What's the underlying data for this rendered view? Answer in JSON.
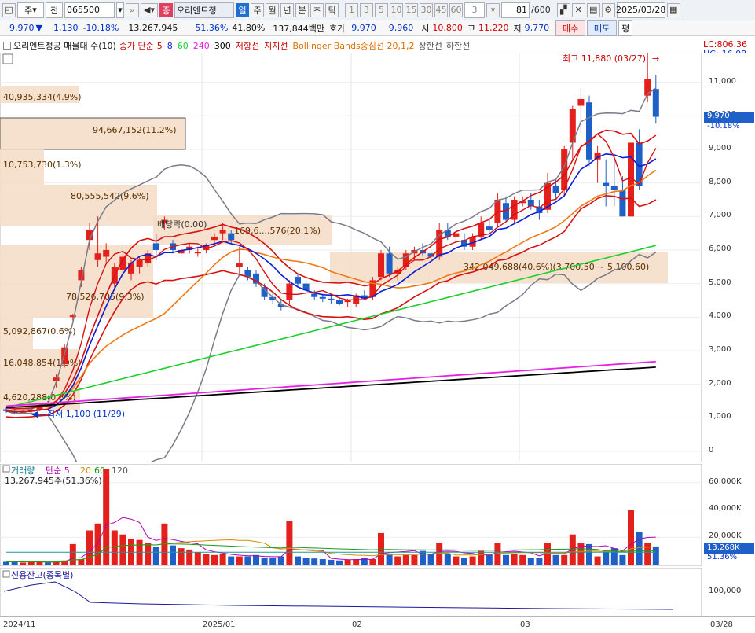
{
  "toolbar": {
    "stock_type": "주",
    "search_type": "전",
    "code": "065500",
    "market_badge": "증",
    "stock_name": "오리엔트정",
    "periods": [
      "일",
      "주",
      "월",
      "년",
      "분",
      "초",
      "틱"
    ],
    "minute_steps": [
      "1",
      "3",
      "5",
      "10",
      "15",
      "30",
      "45",
      "60"
    ],
    "custom_step": "3",
    "page_count": "81",
    "page_total": "/600",
    "date": "2025/03/28"
  },
  "quote": {
    "price": "9,970",
    "direction": "▼",
    "change": "1,130",
    "change_rate": "-10.18%",
    "volume": "13,267,945",
    "volume_rate": "51.36%",
    "turnover": "41.80%",
    "amount": "137,844백만",
    "ask_label": "호가",
    "ask1": "9,970",
    "ask2": "9,960",
    "open_label": "시",
    "open": "10,800",
    "high_label": "고",
    "high": "11,220",
    "low_label": "저",
    "low": "9,770",
    "buy_btn": "매수",
    "sell_btn": "매도",
    "eval_btn": "평"
  },
  "legend": {
    "stock": "오리엔트정공 매물대 수(10)",
    "close_label": "종가 단순",
    "ma": [
      "5",
      "8",
      "60",
      "240",
      "300"
    ],
    "lowline": "저항선",
    "support": "지지선",
    "bollinger": "Bollinger Bands중심선 20,1,2",
    "upper": "상한선",
    "lower": "하한선"
  },
  "price_pane": {
    "lc_label": "LC:806.36",
    "hc_label": "HC:-16.08",
    "high_note": "최고 11,880 (03/27)",
    "low_note": "최저 1,100 (11/29)",
    "dividend_note": "배당락(0.00)",
    "current_tag": "9,970",
    "current_rate": "-10.18%",
    "y_ticks": [
      "11,000",
      "10,000",
      "9,000",
      "8,000",
      "7,000",
      "6,000",
      "5,000",
      "4,000",
      "3,000",
      "2,000",
      "1,000",
      "0"
    ],
    "volume_profile": [
      {
        "label": "40,935,334(4.9%)"
      },
      {
        "label": "94,667,152(11.2%)"
      },
      {
        "label": "10,753,730(1.3%)"
      },
      {
        "label": "80,555,542(9.6%)"
      },
      {
        "label": "169,6...,576(20.1%)"
      },
      {
        "label": "78,526,705(9.3%)"
      },
      {
        "label": "5,092,867(0.6%)"
      },
      {
        "label": "16,048,854(1.9%)"
      },
      {
        "label": "4,620,288(0.5%)"
      },
      {
        "label": "342,049,688(40.6%)(3,700.50 ~ 5,100.60)"
      }
    ]
  },
  "volume_pane": {
    "title": "거래량",
    "ma_label": "단순",
    "ma": [
      "5",
      "20",
      "60",
      "120"
    ],
    "current": "13,267,945주(51.36%)",
    "y_ticks": [
      "60,000K",
      "40,000K",
      "20,000K"
    ],
    "current_tag": "13,268K",
    "current_rate": "51.36%"
  },
  "credit_pane": {
    "title": "신용잔고(종목별)",
    "y_tick": "100,000"
  },
  "date_axis": [
    "2024/11",
    "2025/01",
    "02",
    "03",
    "03/28"
  ],
  "colors": {
    "up": "#e3201b",
    "down": "#1f5fc8",
    "bg_profile": "#f3dcc4",
    "ma5": "#0a1fd8",
    "ma20": "#ee7a16",
    "ma60": "#1ad12c",
    "ma240": "#e620e6",
    "ma300": "#000000",
    "bb": "#7a7a8a",
    "env": "#d81010"
  }
}
